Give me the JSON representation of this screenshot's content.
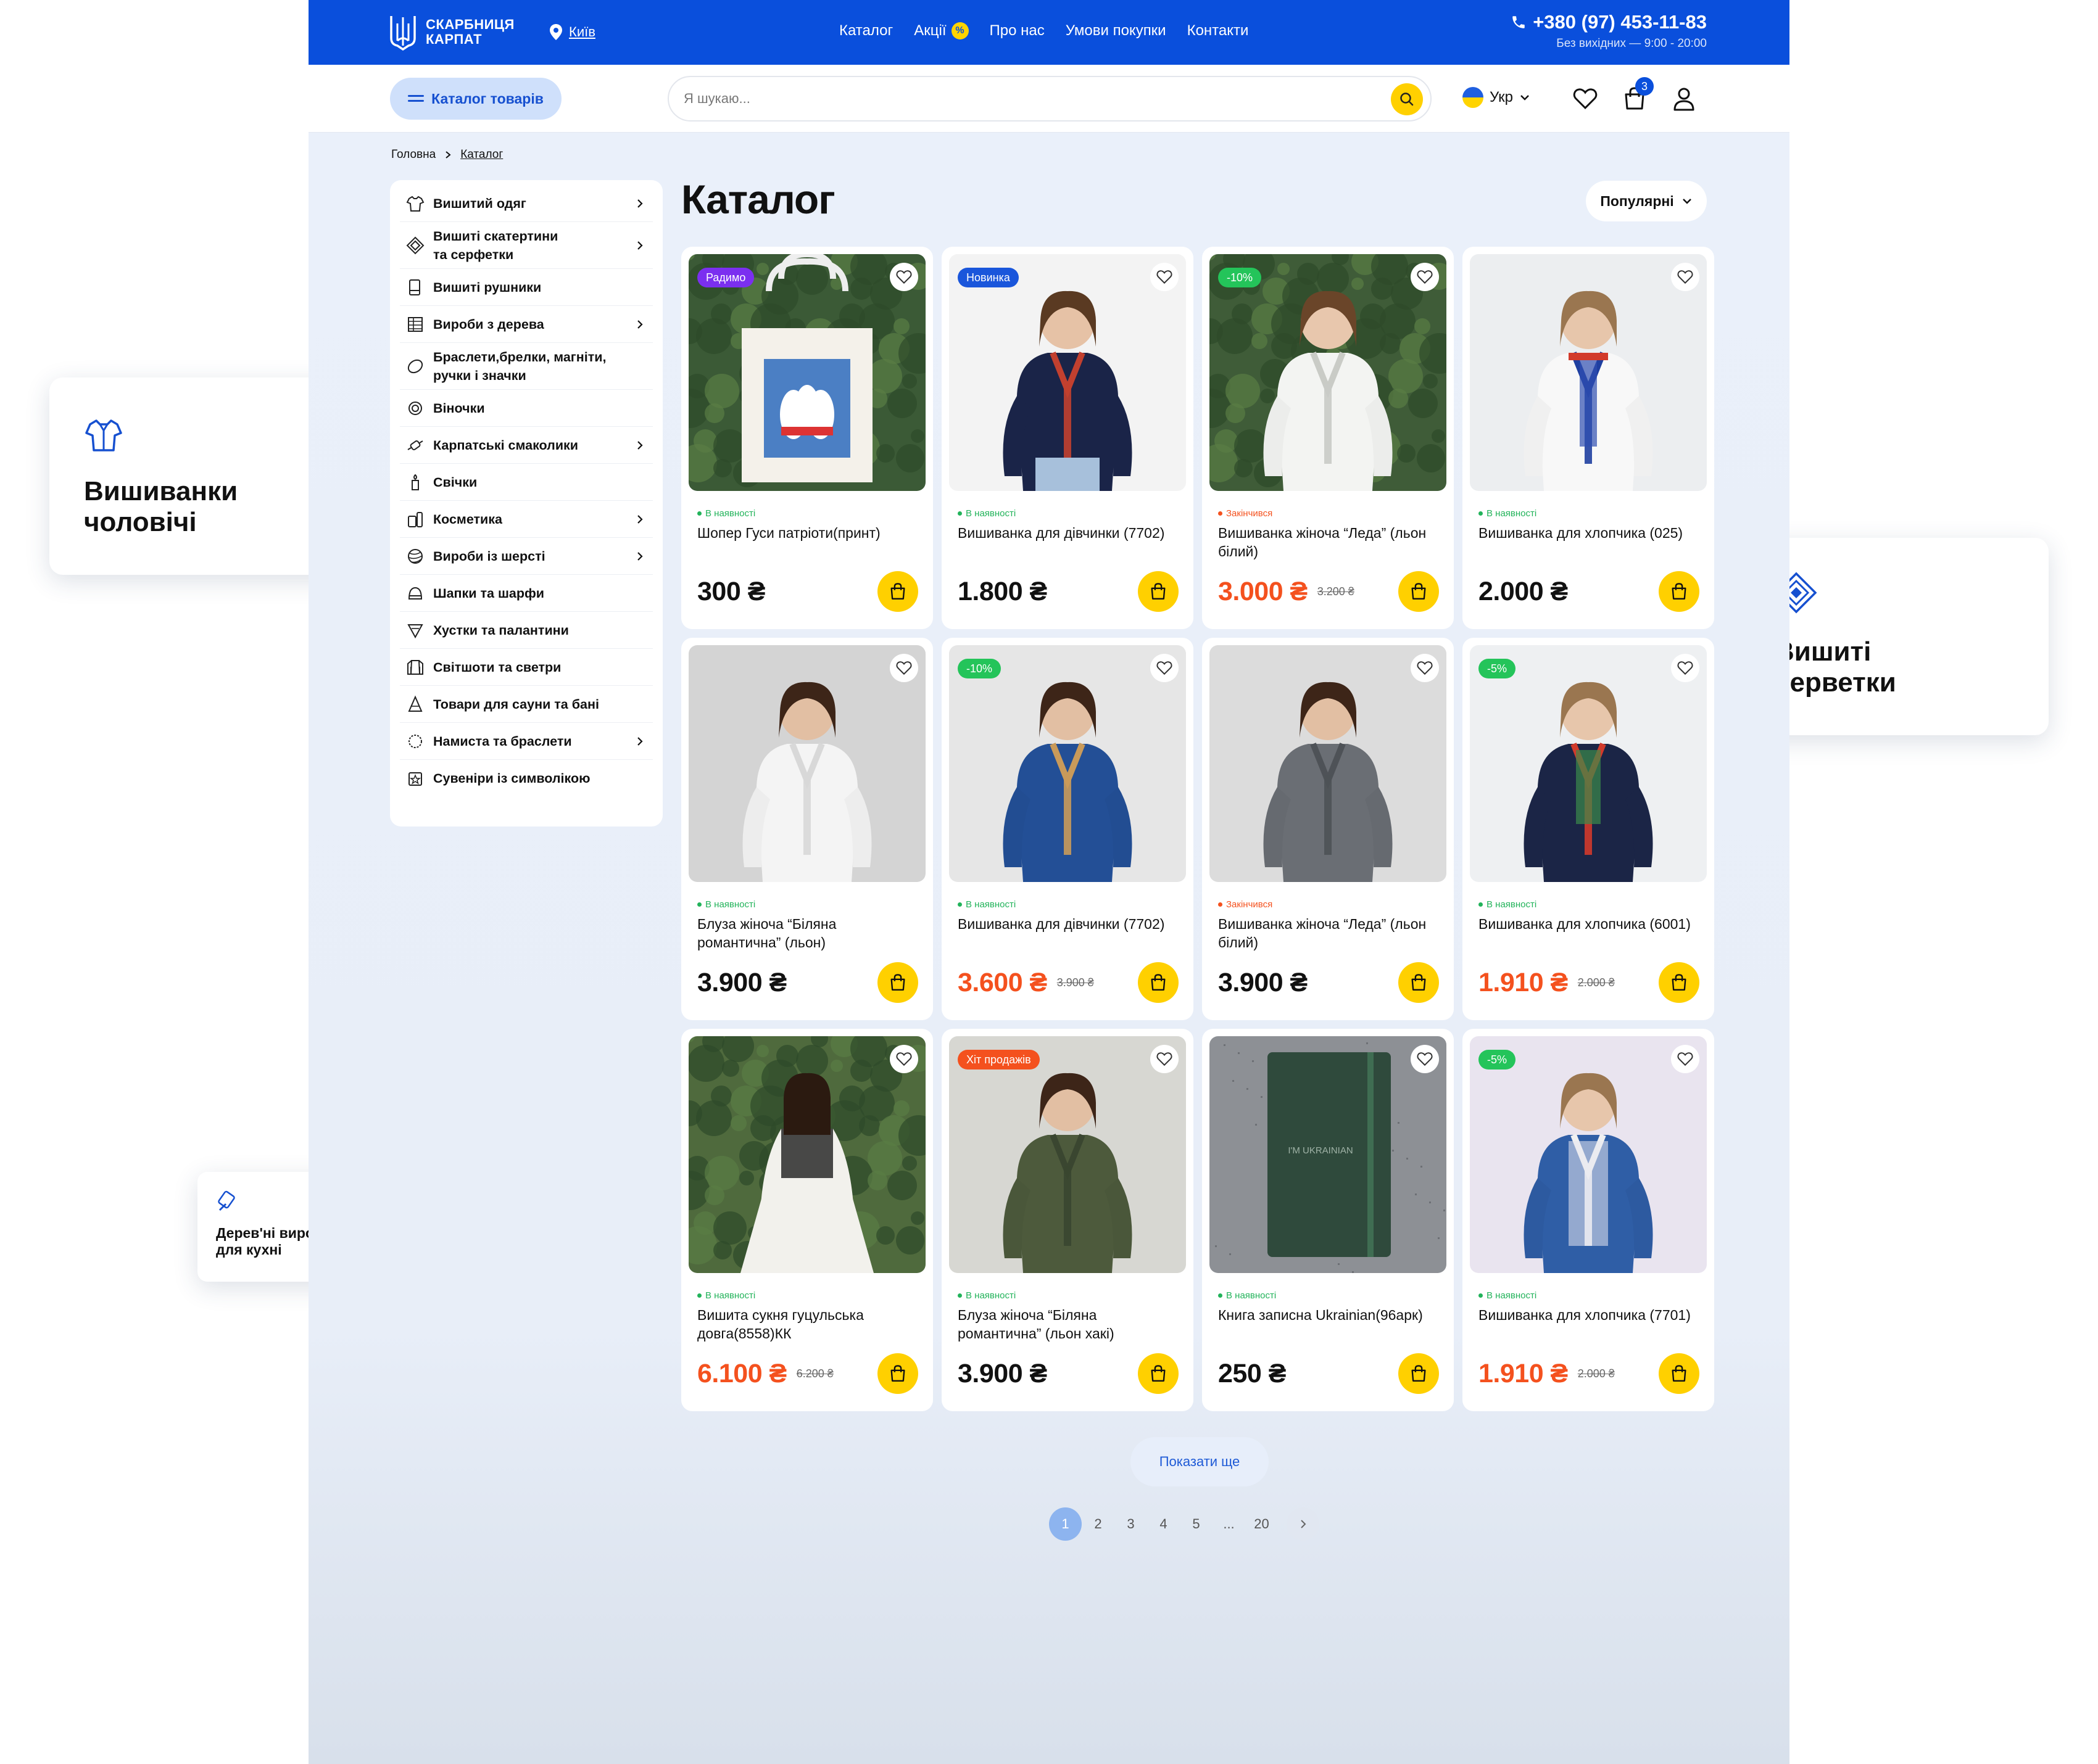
{
  "header": {
    "logo_line1": "СКАРБНИЦЯ",
    "logo_line2": "КАРПАТ",
    "city": "Київ",
    "nav": [
      {
        "label": "Каталог"
      },
      {
        "label": "Акції",
        "badge": "%"
      },
      {
        "label": "Про нас"
      },
      {
        "label": "Умови покупки"
      },
      {
        "label": "Контакти"
      }
    ],
    "phone": "+380 (97) 453-11-83",
    "hours": "Без вихідних — 9:00 - 20:00",
    "accent": "#0a4fdc"
  },
  "subbar": {
    "catalog_button": "Каталог товарів",
    "search_placeholder": "Я шукаю...",
    "language": "Укр",
    "cart_count": "3"
  },
  "breadcrumb": {
    "home": "Головна",
    "current": "Каталог"
  },
  "sidebar": {
    "items": [
      {
        "label": "Вишитий одяг",
        "icon": "shirt-icon",
        "chevron": true
      },
      {
        "label": "Вишиті скатертини\nта серфетки",
        "icon": "diamond-icon",
        "chevron": true
      },
      {
        "label": "Вишиті рушники",
        "icon": "towel-icon",
        "chevron": false
      },
      {
        "label": "Вироби з дерева",
        "icon": "wood-icon",
        "chevron": true
      },
      {
        "label": "Браслети,брелки, магніти,\nручки і значки",
        "icon": "bracelet-icon",
        "chevron": false
      },
      {
        "label": "Віночки",
        "icon": "wreath-icon",
        "chevron": false
      },
      {
        "label": "Карпатські смаколики",
        "icon": "candy-icon",
        "chevron": true
      },
      {
        "label": "Свічки",
        "icon": "candle-icon",
        "chevron": false
      },
      {
        "label": "Косметика",
        "icon": "cosmetics-icon",
        "chevron": true
      },
      {
        "label": "Вироби із шерсті",
        "icon": "yarn-icon",
        "chevron": true
      },
      {
        "label": "Шапки та шарфи",
        "icon": "hat-icon",
        "chevron": false
      },
      {
        "label": "Хустки та палантини",
        "icon": "scarf-icon",
        "chevron": false
      },
      {
        "label": "Світшоти та светри",
        "icon": "sweater-icon",
        "chevron": false
      },
      {
        "label": "Товари для сауни та бані",
        "icon": "sauna-icon",
        "chevron": false
      },
      {
        "label": "Намиста та браслети",
        "icon": "necklace-icon",
        "chevron": true
      },
      {
        "label": "Сувеніри із символікою",
        "icon": "souvenir-icon",
        "chevron": false
      }
    ]
  },
  "main": {
    "title": "Каталог",
    "sort_label": "Популярні",
    "show_more": "Показати ще",
    "pagination": [
      "1",
      "2",
      "3",
      "4",
      "5",
      "...",
      "20"
    ],
    "current_page": "1"
  },
  "products": [
    {
      "name": "Шопер Гуси патріоти(принт)",
      "status": "В наявності",
      "status_type": "in",
      "price": "300 ₴",
      "old_price": "",
      "sale": false,
      "badge": "Радимо",
      "badge_color": "#7b2ff0",
      "art": "tote"
    },
    {
      "name": "Вишиванка для дівчинки (7702)",
      "status": "В наявності",
      "status_type": "in",
      "price": "1.800 ₴",
      "old_price": "",
      "sale": false,
      "badge": "Новинка",
      "badge_color": "#1a56db",
      "art": "navy-girl"
    },
    {
      "name": "Вишиванка жіноча “Леда” (льон білий)",
      "status": "Закінчився",
      "status_type": "out",
      "price": "3.000 ₴",
      "old_price": "3.200 ₴",
      "sale": true,
      "badge": "-10%",
      "badge_color": "#24c45a",
      "art": "white-girl"
    },
    {
      "name": "Вишиванка для хлопчика (025)",
      "status": "В наявності",
      "status_type": "in",
      "price": "2.000 ₴",
      "old_price": "",
      "sale": false,
      "badge": "",
      "badge_color": "",
      "art": "white-boy"
    },
    {
      "name": "Блуза жіноча “Біляна романтична” (льон)",
      "status": "В наявності",
      "status_type": "in",
      "price": "3.900 ₴",
      "old_price": "",
      "sale": false,
      "badge": "",
      "badge_color": "",
      "art": "white-blouse"
    },
    {
      "name": "Вишиванка для дівчинки (7702)",
      "status": "В наявності",
      "status_type": "in",
      "price": "3.600 ₴",
      "old_price": "3.900 ₴",
      "sale": true,
      "badge": "-10%",
      "badge_color": "#24c45a",
      "art": "blue-blouse"
    },
    {
      "name": "Вишиванка жіноча “Леда” (льон білий)",
      "status": "Закінчився",
      "status_type": "out",
      "price": "3.900 ₴",
      "old_price": "",
      "sale": false,
      "badge": "",
      "badge_color": "",
      "art": "grey-blouse"
    },
    {
      "name": "Вишиванка для хлопчика (6001)",
      "status": "В наявності",
      "status_type": "in",
      "price": "1.910 ₴",
      "old_price": "2.000 ₴",
      "sale": true,
      "badge": "-5%",
      "badge_color": "#24c45a",
      "art": "navy-boy"
    },
    {
      "name": "Вишита сукня гуцульська довга(8558)КК",
      "status": "В наявності",
      "status_type": "in",
      "price": "6.100 ₴",
      "old_price": "6.200 ₴",
      "sale": true,
      "badge": "",
      "badge_color": "",
      "art": "dress"
    },
    {
      "name": "Блуза жіноча “Біляна романтична” (льон хакі)",
      "status": "В наявності",
      "status_type": "in",
      "price": "3.900 ₴",
      "old_price": "",
      "sale": false,
      "badge": "Хіт продажів",
      "badge_color": "#f4511e",
      "art": "khaki-blouse"
    },
    {
      "name": "Книга записна Ukrainian(96арк)",
      "status": "В наявності",
      "status_type": "in",
      "price": "250 ₴",
      "old_price": "",
      "sale": false,
      "badge": "",
      "badge_color": "",
      "art": "notebook",
      "art_text": "I'M UKRAINIAN"
    },
    {
      "name": "Вишиванка для хлопчика (7701)",
      "status": "В наявності",
      "status_type": "in",
      "price": "1.910 ₴",
      "old_price": "2.000 ₴",
      "sale": true,
      "badge": "-5%",
      "badge_color": "#24c45a",
      "art": "blue-boy"
    }
  ],
  "floating_cards": {
    "left_top": {
      "title": "Вишиванки\nчоловічі",
      "icon": "shirt-icon"
    },
    "right": {
      "title": "Вишиті\nсерветки",
      "icon": "napkin-icon"
    },
    "left_bottom": {
      "title": "Дерев'ні вироби\nдля кухні",
      "icon": "kitchen-wood-icon"
    }
  },
  "colors": {
    "in_stock": "#22b35a",
    "out_of_stock": "#f4511e",
    "sale_price": "#f4511e",
    "buy_button": "#ffd000"
  }
}
